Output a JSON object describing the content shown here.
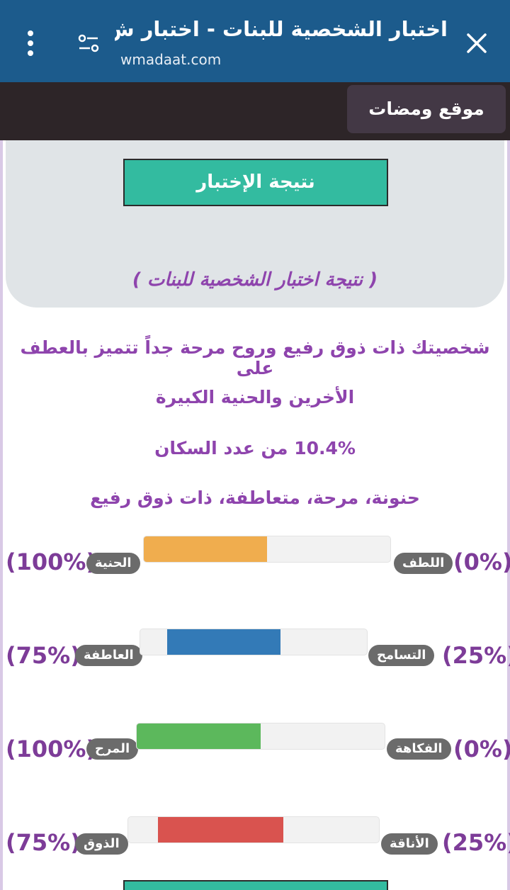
{
  "browser": {
    "title": "اختبار الشخصية للبنات - اختبار ش...",
    "url": "wmadaat.com"
  },
  "site": {
    "name_button": "موقع ومضات"
  },
  "quiz": {
    "result_button": "نتيجة الإختبار",
    "result_heading": "( نتيجة اختبار الشخصية للبنات )",
    "description_line1": "شخصيتك ذات ذوق رفيع وروح مرحة جداً تتميز بالعطف على",
    "description_line2": "الأخرين والحنية الكبيرة",
    "population_share": "10.4% من عدد السكان",
    "traits_summary": "حنونة، مرحة، متعاطفة، ذات ذوق رفيع"
  },
  "scales": [
    {
      "left_pct": "(100%)",
      "left_label": "الحنية",
      "right_label": "اللطف",
      "right_pct": "(0%)",
      "fill_color": "#f0ad4e",
      "fill_start": 0.0,
      "fill_end": 0.5
    },
    {
      "left_pct": "(75%)",
      "left_label": "العاطفة",
      "right_label": "التسامح",
      "right_pct": "(25%)",
      "fill_color": "#337ab7",
      "fill_start": 0.12,
      "fill_end": 0.62
    },
    {
      "left_pct": "(100%)",
      "left_label": "المرح",
      "right_label": "الفكاهة",
      "right_pct": "(0%)",
      "fill_color": "#5cb85c",
      "fill_start": 0.0,
      "fill_end": 0.5
    },
    {
      "left_pct": "(75%)",
      "left_label": "الذوق",
      "right_label": "الأناقة",
      "right_pct": "(25%)",
      "fill_color": "#d9534f",
      "fill_start": 0.12,
      "fill_end": 0.62
    }
  ],
  "colors": {
    "browser_bar": "#1c5b8c",
    "accent_purple": "#8e44ad",
    "button_teal": "#33bba0"
  }
}
